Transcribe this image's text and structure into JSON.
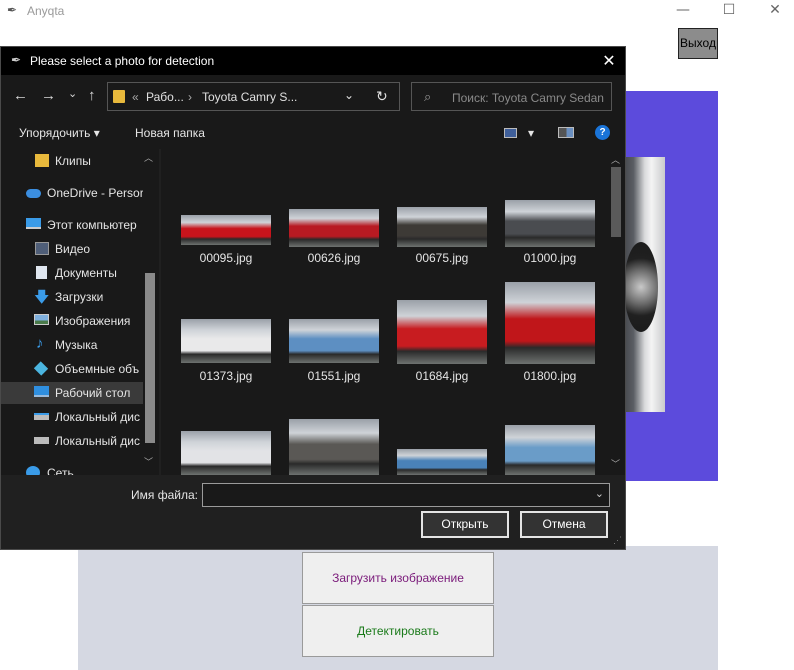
{
  "app": {
    "title": "Anyqta",
    "controls": {
      "minimize": "—",
      "maximize": "☐",
      "close": "✕"
    },
    "exit_label": "Выход",
    "load_label": "Загрузить изображение",
    "detect_label": "Детектировать",
    "colors": {
      "panel": "#5c4bdc",
      "load_text": "#7a1a7a",
      "detect_text": "#1a7a1a"
    }
  },
  "dialog": {
    "title": "Please select a photo for detection",
    "close": "✕",
    "nav": {
      "back": "←",
      "forward": "→",
      "dropdown": "⌄",
      "up": "↑",
      "refresh": "↻"
    },
    "breadcrumb": {
      "prefix": "«",
      "part1": "Рабо...",
      "sep": "›",
      "part2": "Toyota Camry S...",
      "chevron": "⌄"
    },
    "search_placeholder": "Поиск: Toyota Camry Sedan",
    "toolbar": {
      "organize": "Упорядочить ▾",
      "new_folder": "Новая папка",
      "view": "▾",
      "help": "?"
    },
    "sidebar": [
      {
        "label": "Клипы",
        "icon": "folder-icon"
      },
      {
        "label": "OneDrive - Persor",
        "icon": "cloud-icon"
      },
      {
        "label": "Этот компьютер",
        "icon": "computer-icon"
      },
      {
        "label": "Видео",
        "icon": "video-icon"
      },
      {
        "label": "Документы",
        "icon": "document-icon"
      },
      {
        "label": "Загрузки",
        "icon": "download-icon"
      },
      {
        "label": "Изображения",
        "icon": "pictures-icon"
      },
      {
        "label": "Музыка",
        "icon": "music-icon"
      },
      {
        "label": "Объемные объ",
        "icon": "3d-objects-icon"
      },
      {
        "label": "Рабочий стол",
        "icon": "desktop-icon"
      },
      {
        "label": "Локальный дис",
        "icon": "drive-icon"
      },
      {
        "label": "Локальный дис",
        "icon": "drive-icon"
      },
      {
        "label": "Сеть",
        "icon": "network-icon"
      }
    ],
    "files": [
      {
        "name": "00095.jpg",
        "color": "#c8141c"
      },
      {
        "name": "00626.jpg",
        "color": "#b81a22"
      },
      {
        "name": "00675.jpg",
        "color": "#3d3a36"
      },
      {
        "name": "01000.jpg",
        "color": "#4a4c50"
      },
      {
        "name": "01373.jpg",
        "color": "#e9e9ea"
      },
      {
        "name": "01551.jpg",
        "color": "#5d8fc2"
      },
      {
        "name": "01684.jpg",
        "color": "#c81c20"
      },
      {
        "name": "01800.jpg",
        "color": "#c0161a"
      },
      {
        "name": "",
        "color": "#e2e3e6"
      },
      {
        "name": "",
        "color": "#5a5855"
      },
      {
        "name": "",
        "color": "#4a82b8"
      },
      {
        "name": "",
        "color": "#6a9cc8"
      }
    ],
    "filename_label": "Имя файла:",
    "filename_value": "",
    "open_label": "Открыть",
    "cancel_label": "Отмена"
  }
}
